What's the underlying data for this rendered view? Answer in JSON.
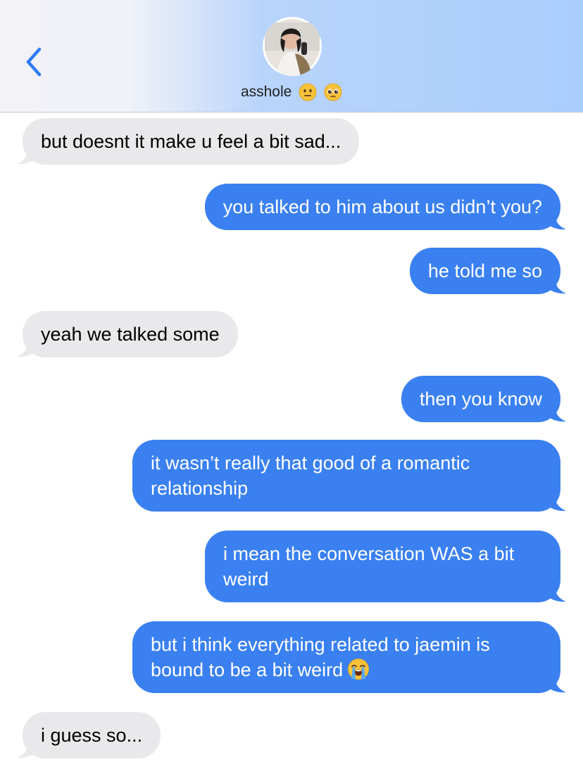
{
  "header": {
    "contact_name": "asshole",
    "name_emojis": [
      "neutral-face-icon",
      "pleading-face-icon"
    ]
  },
  "colors": {
    "outgoing_bubble": "#3a80f0",
    "incoming_bubble": "#e9e9eb",
    "back_chevron": "#2f7cf6"
  },
  "messages": [
    {
      "direction": "incoming",
      "text": "but doesnt it make u feel a bit sad..."
    },
    {
      "direction": "outgoing",
      "text": "you talked to him about us didn’t you?"
    },
    {
      "direction": "outgoing",
      "text": "he told me so"
    },
    {
      "direction": "incoming",
      "text": "yeah we talked some"
    },
    {
      "direction": "outgoing",
      "text": "then you know"
    },
    {
      "direction": "outgoing",
      "text": "it wasn’t really that good of a romantic relationship"
    },
    {
      "direction": "outgoing",
      "text": "i mean the conversation WAS a bit weird"
    },
    {
      "direction": "outgoing",
      "text": "but i think everything related to jaemin is bound to be a bit weird",
      "emoji": "loudly-crying-face-icon"
    },
    {
      "direction": "incoming",
      "text": "i guess so..."
    }
  ]
}
